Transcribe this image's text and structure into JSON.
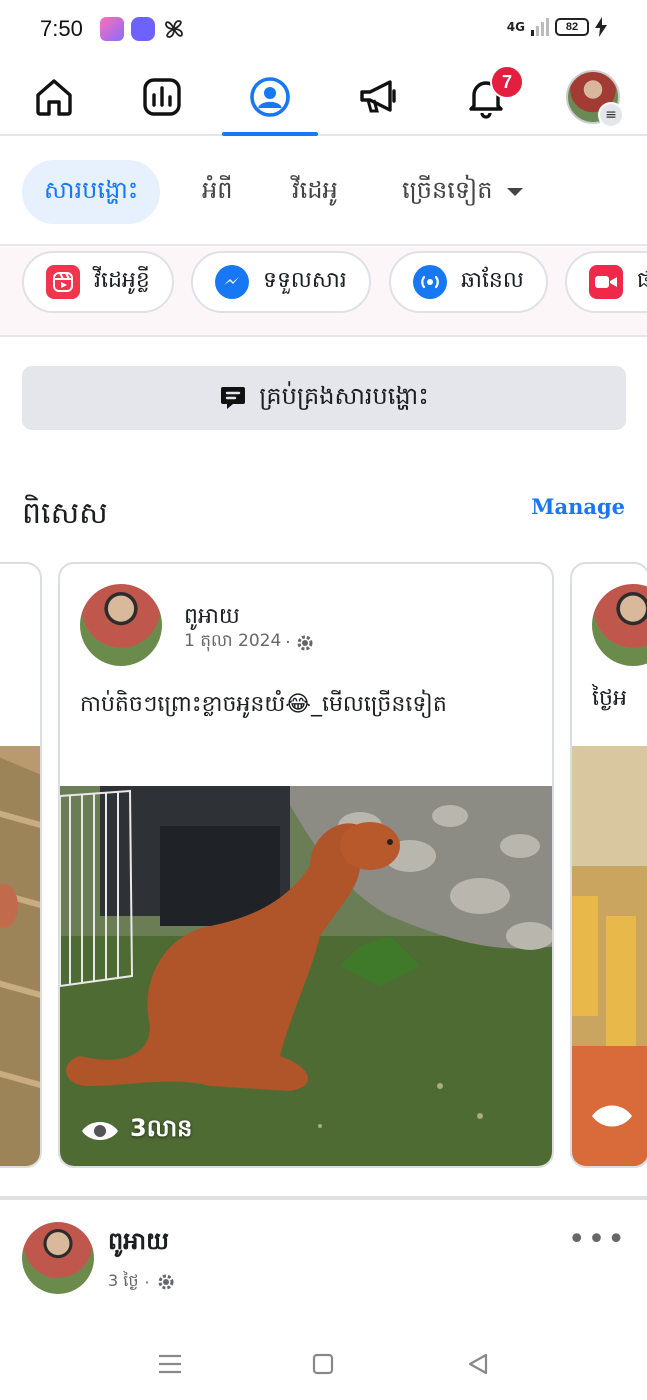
{
  "status_bar": {
    "time": "7:50",
    "network": "4G",
    "battery": "82"
  },
  "top_nav": {
    "notification_count": "7",
    "active_tab": "profile",
    "accent": "#1877f2"
  },
  "profile_tabs": [
    {
      "label": "សារបង្ហោះ",
      "active": true
    },
    {
      "label": "អំពី",
      "active": false
    },
    {
      "label": "វីដេអូ",
      "active": false
    },
    {
      "label": "ច្រើនទៀត",
      "active": false
    }
  ],
  "chips": [
    {
      "label": "វីដេអូខ្លី",
      "icon": "reels-icon"
    },
    {
      "label": "ទទួលសារ",
      "icon": "messenger-icon"
    },
    {
      "label": "ឆានែល",
      "icon": "channel-icon"
    },
    {
      "label": "ផ",
      "icon": "live-video-icon"
    }
  ],
  "manage_posts": {
    "label": "គ្រប់គ្រងសារបង្ហោះ"
  },
  "featured": {
    "title": "ពិសេស",
    "manage_label": "Manage",
    "card": {
      "author": "ពូអាយ",
      "date": "1 តុលា 2024",
      "caption": "កាប់តិចៗព្រោះខ្លាចអូនយំ😂_មើលច្រើនទៀត",
      "views": "3លាន"
    },
    "right_card_caption": "ថ្ងៃអ"
  },
  "post": {
    "author": "ពូអាយ",
    "time": "3 ថ្ងៃ",
    "more": "•••"
  }
}
